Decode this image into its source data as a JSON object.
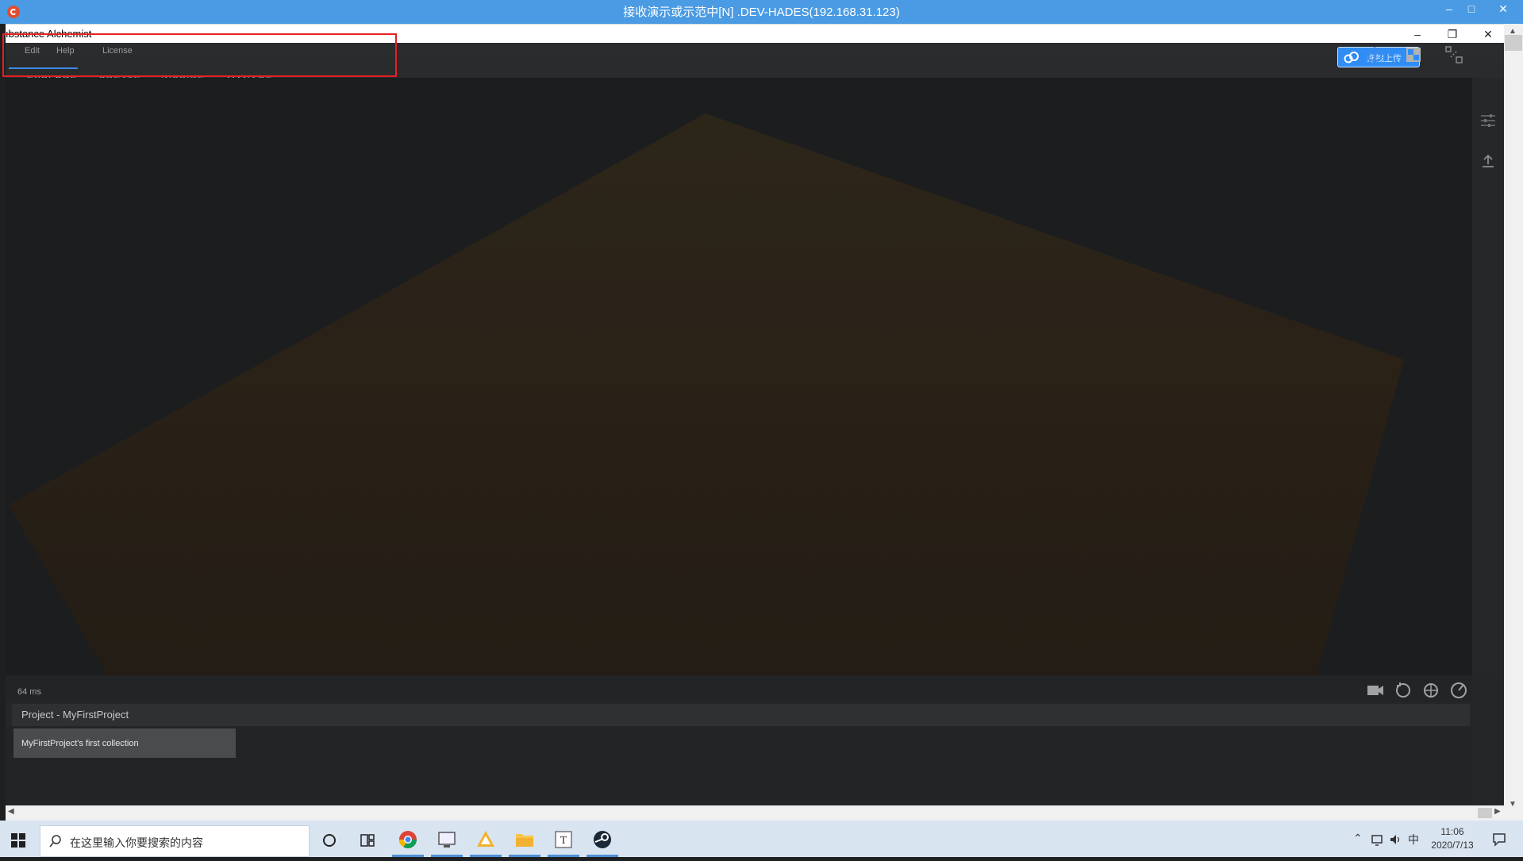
{
  "remote_window": {
    "title": "接收演示或示范中[N] .DEV-HADES(192.168.31.123)",
    "controls": [
      "–",
      "□",
      "✕"
    ]
  },
  "app": {
    "title": "ıbstance Alchemist",
    "controls": [
      "–",
      "❐",
      "✕"
    ],
    "menu": [
      "Edit",
      "Help",
      "License"
    ],
    "tabs": [
      {
        "label": "EXPLORE",
        "active": true
      },
      {
        "label": "CREATE",
        "active": false
      },
      {
        "label": "INSPIRE",
        "active": false
      },
      {
        "label": "MANAGE",
        "active": false
      }
    ],
    "upload_button_label": "拖拽上传",
    "render_time": "64 ms",
    "project_title": "Project - MyFirstProject",
    "collection_label": "MyFirstProject's first collection"
  },
  "colors": {
    "accent": "#3d8be8",
    "highlight_box": "#e62020",
    "remote_bar": "#4a9be3"
  },
  "taskbar": {
    "search_placeholder": "在这里输入你要搜索的内容",
    "apps": [
      "cortana-icon",
      "task-view-icon",
      "chrome-icon",
      "monitor-app-icon",
      "triangle-app-icon",
      "file-explorer-icon",
      "typora-icon",
      "steam-icon"
    ],
    "tray": {
      "ime": "中"
    },
    "clock": {
      "time": "11:06",
      "date": "2020/7/13"
    }
  }
}
